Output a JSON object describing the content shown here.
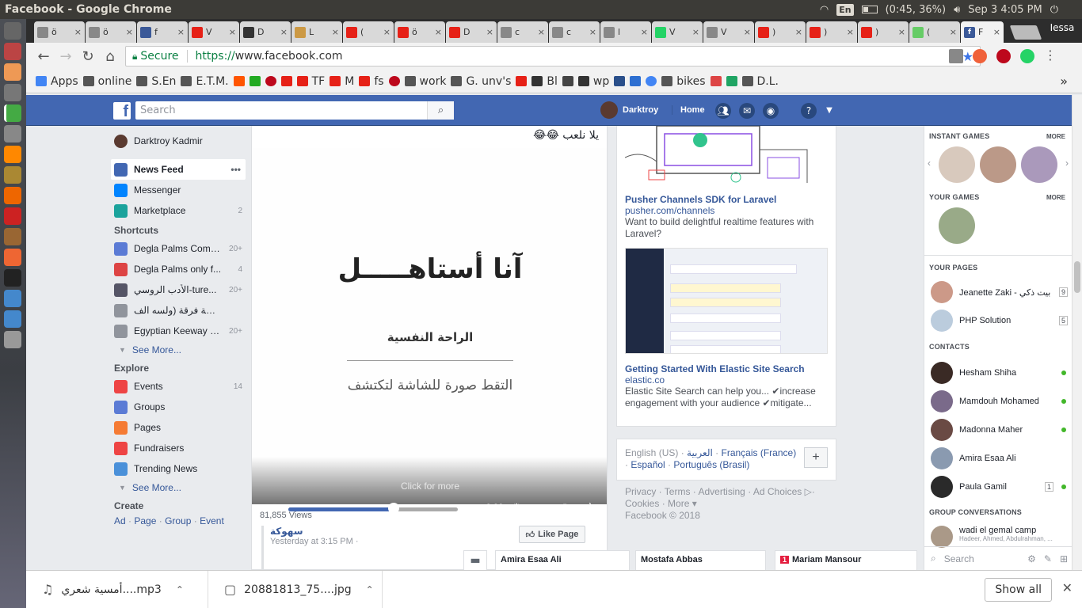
{
  "system": {
    "window_title": "Facebook - Google Chrome",
    "input_lang": "En",
    "battery": "(0:45, 36%)",
    "clock": "Sep  3  4:05 PM"
  },
  "browser": {
    "profile": "Iessa",
    "tabs": [
      {
        "label": "ö",
        "color": "#888"
      },
      {
        "label": "ö",
        "color": "#888"
      },
      {
        "label": "f",
        "color": "#3b5998"
      },
      {
        "label": "V",
        "color": "#e62117"
      },
      {
        "label": "D",
        "color": "#333"
      },
      {
        "label": "L",
        "color": "#c94"
      },
      {
        "label": "(",
        "color": "#e62117"
      },
      {
        "label": "ö",
        "color": "#e62117"
      },
      {
        "label": "D",
        "color": "#e62117"
      },
      {
        "label": "c",
        "color": "#888"
      },
      {
        "label": "c",
        "color": "#888"
      },
      {
        "label": "l",
        "color": "#888"
      },
      {
        "label": "V",
        "color": "#25d366"
      },
      {
        "label": "V",
        "color": "#888"
      },
      {
        "label": ")",
        "color": "#e62117"
      },
      {
        "label": ")",
        "color": "#e62117"
      },
      {
        "label": ")",
        "color": "#e62117"
      },
      {
        "label": "(",
        "color": "#6c6"
      }
    ],
    "active_tab": {
      "label": "F",
      "color": "#3b5998"
    },
    "secure_label": "Secure",
    "url_scheme": "https://",
    "url_host": "www.facebook.com",
    "bookmarks": [
      {
        "label": "Apps",
        "type": "apps"
      },
      {
        "label": "online",
        "type": "folder"
      },
      {
        "label": "S.En",
        "type": "folder"
      },
      {
        "label": "E.T.M.",
        "type": "folder"
      },
      {
        "label": "",
        "type": "soundcloud"
      },
      {
        "label": "",
        "type": "ftu"
      },
      {
        "label": "",
        "type": "pin"
      },
      {
        "label": "",
        "type": "yt"
      },
      {
        "label": "TF",
        "type": "yt"
      },
      {
        "label": "M",
        "type": "yt"
      },
      {
        "label": "fs",
        "type": "yt"
      },
      {
        "label": "",
        "type": "pin"
      },
      {
        "label": "work",
        "type": "folder"
      },
      {
        "label": "G. unv's",
        "type": "folder"
      },
      {
        "label": "",
        "type": "yt"
      },
      {
        "label": "Bl",
        "type": "dark"
      },
      {
        "label": "",
        "type": "dl"
      },
      {
        "label": "wp",
        "type": "dark"
      },
      {
        "label": "",
        "type": "w3"
      },
      {
        "label": "",
        "type": "cloud"
      },
      {
        "label": "",
        "type": "google"
      },
      {
        "label": "bikes",
        "type": "folder"
      },
      {
        "label": "",
        "type": "gmail"
      },
      {
        "label": "",
        "type": "drive"
      },
      {
        "label": "D.L.",
        "type": "folder"
      }
    ]
  },
  "fb_header": {
    "search_placeholder": "Search",
    "user_name": "Darktroy",
    "home_label": "Home"
  },
  "left_nav": {
    "profile_name": "Darktroy Kadmir",
    "main": [
      {
        "label": "News Feed",
        "count": "",
        "selected": true,
        "color": "#4267b2"
      },
      {
        "label": "Messenger",
        "count": "",
        "color": "#0084ff"
      },
      {
        "label": "Marketplace",
        "count": "2",
        "color": "#1ba39c"
      }
    ],
    "shortcuts_header": "Shortcuts",
    "shortcuts": [
      {
        "label": "Degla Palms Comp...",
        "count": "20+",
        "color": "#5b7bd5"
      },
      {
        "label": "Degla Palms only f...",
        "count": "4",
        "color": "#d44"
      },
      {
        "label": "الأدب الروسي-ture...",
        "count": "20+",
        "color": "#556"
      },
      {
        "label": "ورشة فرقة (ولسه الف .",
        "count": "",
        "color": "#90949c"
      },
      {
        "label": "Egyptian Keeway S...",
        "count": "20+",
        "color": "#90949c"
      }
    ],
    "see_more": "See More...",
    "explore_header": "Explore",
    "explore": [
      {
        "label": "Events",
        "count": "14",
        "color": "#e44"
      },
      {
        "label": "Groups",
        "count": "",
        "color": "#5b7bd5"
      },
      {
        "label": "Pages",
        "count": "",
        "color": "#f57b34"
      },
      {
        "label": "Fundraisers",
        "count": "",
        "color": "#e44"
      },
      {
        "label": "Trending News",
        "count": "",
        "color": "#4a90d9"
      }
    ],
    "see_more2": "See More...",
    "create_header": "Create",
    "create_links": [
      "Ad",
      "Page",
      "Group",
      "Event"
    ]
  },
  "post": {
    "text": "يلا نلعب 😂😂",
    "video_title": "آنا أستاهـــــل",
    "video_sub1": "الراحة النفسية",
    "video_sub2": "التقط صورة للشاشة لتكتشف",
    "click_more": "Click for more",
    "time_remaining": "-0:06",
    "progress": 0.62,
    "views": "81,855 Views",
    "share_page": "سهوكة",
    "share_time": "Yesterday at 3:15 PM ·",
    "like_page_label": "Like Page"
  },
  "ads": [
    {
      "title": "Pusher Channels SDK for Laravel",
      "url": "pusher.com/channels",
      "desc": "Want to build delightful realtime features with Laravel?"
    },
    {
      "title": "Getting Started With Elastic Site Search",
      "url": "elastic.co",
      "desc": "Elastic Site Search can help you... ✔increase engagement with your audience ✔mitigate..."
    }
  ],
  "languages": {
    "current": "English (US)",
    "others": [
      "العربية",
      "Français (France)",
      "Español",
      "Português (Brasil)"
    ]
  },
  "footer": {
    "links": [
      "Privacy",
      "Terms",
      "Advertising",
      "Ad Choices",
      "Cookies",
      "More"
    ],
    "copyright": "Facebook © 2018"
  },
  "right_sidebar": {
    "instant_games": "INSTANT GAMES",
    "more": "MORE",
    "your_games": "YOUR GAMES",
    "your_pages": "YOUR PAGES",
    "pages": [
      {
        "name": "Jeanette Zaki - بيت ذكي",
        "badge": "9",
        "color": "#c98"
      },
      {
        "name": "PHP Solution",
        "badge": "5",
        "color": "#bcd"
      }
    ],
    "contacts_header": "CONTACTS",
    "contacts": [
      {
        "name": "Hesham Shiha",
        "online": true,
        "badge": "",
        "color": "#3a2a25"
      },
      {
        "name": "Mamdouh Mohamed",
        "online": true,
        "badge": "",
        "color": "#7a6a8a"
      },
      {
        "name": "Madonna Maher",
        "online": true,
        "badge": "",
        "color": "#6a4a44"
      },
      {
        "name": "Amira Esaa Ali",
        "online": false,
        "badge": "",
        "color": "#8a9ab0"
      },
      {
        "name": "Paula Gamil",
        "online": true,
        "badge": "1",
        "color": "#2a2a2a"
      }
    ],
    "group_conv_header": "GROUP CONVERSATIONS",
    "group_name": "wadi el gemal camp",
    "group_members": "Hadeer, Ahmed, Abdulrahman, ...",
    "search_placeholder": "Search"
  },
  "chat_tabs": [
    {
      "name": "Amira Esaa Ali",
      "badge": ""
    },
    {
      "name": "Mostafa Abbas",
      "badge": ""
    },
    {
      "name": "Mariam Mansour",
      "badge": "1"
    }
  ],
  "downloads": [
    {
      "name": "أمسية شعري....mp3",
      "icon": "music-icon"
    },
    {
      "name": "20881813_75....jpg",
      "icon": "image-icon"
    }
  ],
  "downloads_show_all": "Show all"
}
